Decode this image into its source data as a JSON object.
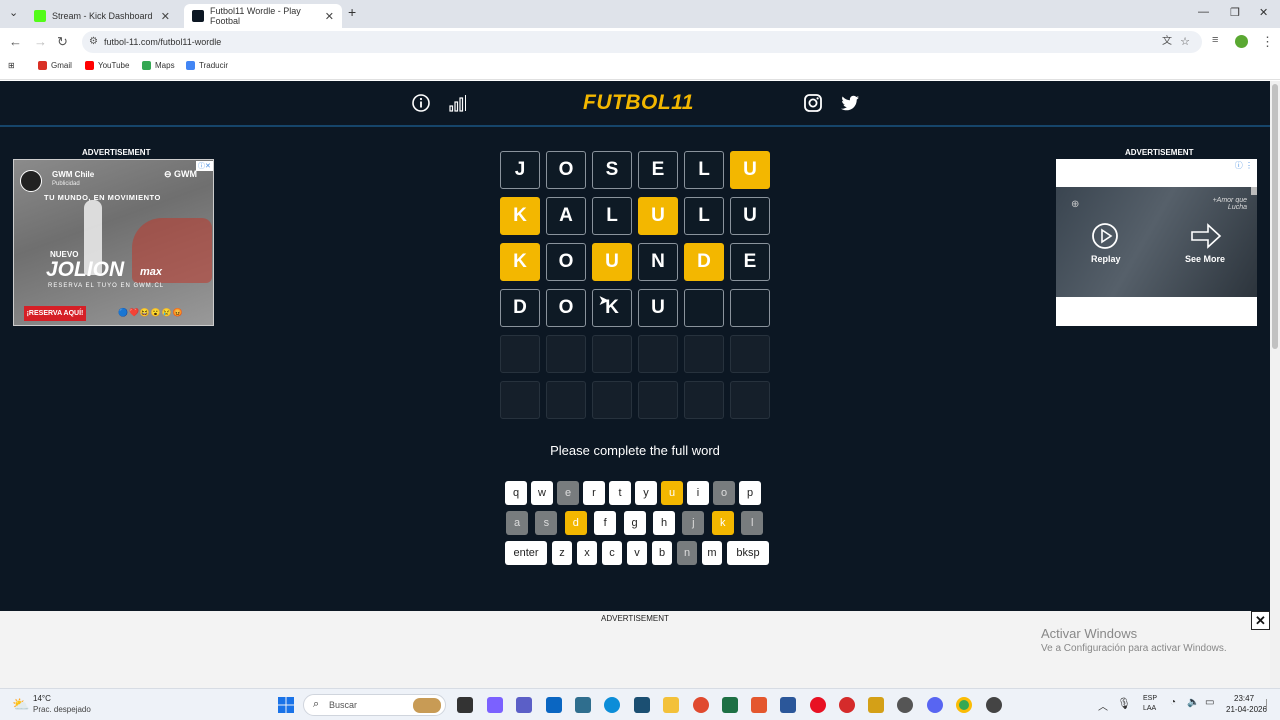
{
  "browser": {
    "tabs": [
      {
        "title": "Stream - Kick Dashboard",
        "icon": "kick-favicon",
        "color": "#53fc18"
      },
      {
        "title": "Futbol11 Wordle - Play Footbal",
        "icon": "futbol11-favicon",
        "color": "#0c1723"
      }
    ],
    "url": "futbol-11.com/futbol11-wordle",
    "bookmarks": [
      "Gmail",
      "YouTube",
      "Maps",
      "Traducir"
    ]
  },
  "site": {
    "logo": "FUTBOL11",
    "ad_label": "ADVERTISEMENT",
    "message": "Please complete the full word"
  },
  "left_ad": {
    "brand": "GWM Chile",
    "sub": "Publicidad",
    "tagline": "TU MUNDO, EN MOVIMIENTO",
    "model_pre": "NUEVO",
    "model": "JOLION",
    "model_suffix": "max",
    "cta_line": "RESERVA EL TUYO EN GWM.CL",
    "button": "¡RESERVA AQUÍ!"
  },
  "right_ad": {
    "replay": "Replay",
    "see_more": "See More",
    "watermark": "+Amor que Lucha"
  },
  "grid": [
    [
      {
        "l": "J",
        "s": "f"
      },
      {
        "l": "O",
        "s": "f"
      },
      {
        "l": "S",
        "s": "f"
      },
      {
        "l": "E",
        "s": "f"
      },
      {
        "l": "L",
        "s": "f"
      },
      {
        "l": "U",
        "s": "y"
      }
    ],
    [
      {
        "l": "K",
        "s": "y"
      },
      {
        "l": "A",
        "s": "f"
      },
      {
        "l": "L",
        "s": "f"
      },
      {
        "l": "U",
        "s": "y"
      },
      {
        "l": "L",
        "s": "f"
      },
      {
        "l": "U",
        "s": "f"
      }
    ],
    [
      {
        "l": "K",
        "s": "y"
      },
      {
        "l": "O",
        "s": "f"
      },
      {
        "l": "U",
        "s": "y"
      },
      {
        "l": "N",
        "s": "f"
      },
      {
        "l": "D",
        "s": "y"
      },
      {
        "l": "E",
        "s": "f"
      }
    ],
    [
      {
        "l": "D",
        "s": "f"
      },
      {
        "l": "O",
        "s": "f"
      },
      {
        "l": "K",
        "s": "f"
      },
      {
        "l": "U",
        "s": "f"
      },
      {
        "l": "",
        "s": "f"
      },
      {
        "l": "",
        "s": "f"
      }
    ],
    [
      {
        "l": "",
        "s": "e"
      },
      {
        "l": "",
        "s": "e"
      },
      {
        "l": "",
        "s": "e"
      },
      {
        "l": "",
        "s": "e"
      },
      {
        "l": "",
        "s": "e"
      },
      {
        "l": "",
        "s": "e"
      }
    ],
    [
      {
        "l": "",
        "s": "e"
      },
      {
        "l": "",
        "s": "e"
      },
      {
        "l": "",
        "s": "e"
      },
      {
        "l": "",
        "s": "e"
      },
      {
        "l": "",
        "s": "e"
      },
      {
        "l": "",
        "s": "e"
      }
    ]
  ],
  "keyboard": [
    [
      {
        "k": "q",
        "s": ""
      },
      {
        "k": "w",
        "s": ""
      },
      {
        "k": "e",
        "s": "g"
      },
      {
        "k": "r",
        "s": ""
      },
      {
        "k": "t",
        "s": ""
      },
      {
        "k": "y",
        "s": ""
      },
      {
        "k": "u",
        "s": "y"
      },
      {
        "k": "i",
        "s": ""
      },
      {
        "k": "o",
        "s": "g"
      },
      {
        "k": "p",
        "s": ""
      }
    ],
    [
      {
        "k": "a",
        "s": "g"
      },
      {
        "k": "s",
        "s": "g"
      },
      {
        "k": "d",
        "s": "y"
      },
      {
        "k": "f",
        "s": ""
      },
      {
        "k": "g",
        "s": ""
      },
      {
        "k": "h",
        "s": ""
      },
      {
        "k": "j",
        "s": "g"
      },
      {
        "k": "k",
        "s": "y"
      },
      {
        "k": "l",
        "s": "g"
      }
    ],
    [
      {
        "k": "enter",
        "s": ""
      },
      {
        "k": "z",
        "s": ""
      },
      {
        "k": "x",
        "s": ""
      },
      {
        "k": "c",
        "s": ""
      },
      {
        "k": "v",
        "s": ""
      },
      {
        "k": "b",
        "s": ""
      },
      {
        "k": "n",
        "s": "g"
      },
      {
        "k": "m",
        "s": ""
      },
      {
        "k": "bksp",
        "s": ""
      }
    ]
  ],
  "watermark": {
    "title": "Activar Windows",
    "sub": "Ve a Configuración para activar Windows."
  },
  "taskbar": {
    "weather_temp": "14°C",
    "weather_desc": "Prac. despejado",
    "search": "Buscar",
    "lang1": "ESP",
    "lang2": "LAA",
    "time": "23:47",
    "date": "21-04-2026"
  }
}
